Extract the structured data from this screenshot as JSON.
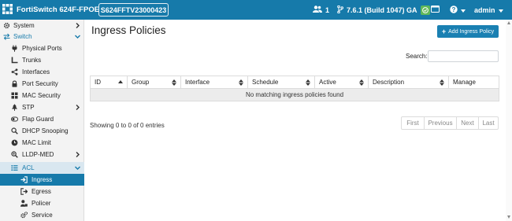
{
  "app": {
    "product": "FortiSwitch 624F-FPOE",
    "serial": "S624FFTV23000423",
    "admin_count": "1",
    "version": "7.6.1 (Build 1047) GA",
    "user": "admin"
  },
  "sidebar": {
    "items": [
      {
        "label": "System"
      },
      {
        "label": "Switch"
      },
      {
        "label": "Physical Ports"
      },
      {
        "label": "Trunks"
      },
      {
        "label": "Interfaces"
      },
      {
        "label": "Port Security"
      },
      {
        "label": "MAC Security"
      },
      {
        "label": "STP"
      },
      {
        "label": "Flap Guard"
      },
      {
        "label": "DHCP Snooping"
      },
      {
        "label": "MAC Limit"
      },
      {
        "label": "LLDP-MED"
      },
      {
        "label": "ACL"
      },
      {
        "label": "Ingress"
      },
      {
        "label": "Egress"
      },
      {
        "label": "Policer"
      },
      {
        "label": "Service"
      }
    ]
  },
  "main": {
    "title": "Ingress Policies",
    "add_button": "Add Ingress Policy",
    "search_label": "Search:",
    "search_value": "",
    "columns": [
      "ID",
      "Group",
      "Interface",
      "Schedule",
      "Active",
      "Description",
      "Manage"
    ],
    "empty_message": "No matching ingress policies found",
    "showing": "Showing 0 to 0 of 0 entries",
    "pager": [
      "First",
      "Previous",
      "Next",
      "Last"
    ]
  },
  "colors": {
    "topbar": "#167aaa",
    "accent": "#1a80b2",
    "highlight": "#f0ff00",
    "status_ok": "#5fb85a"
  }
}
